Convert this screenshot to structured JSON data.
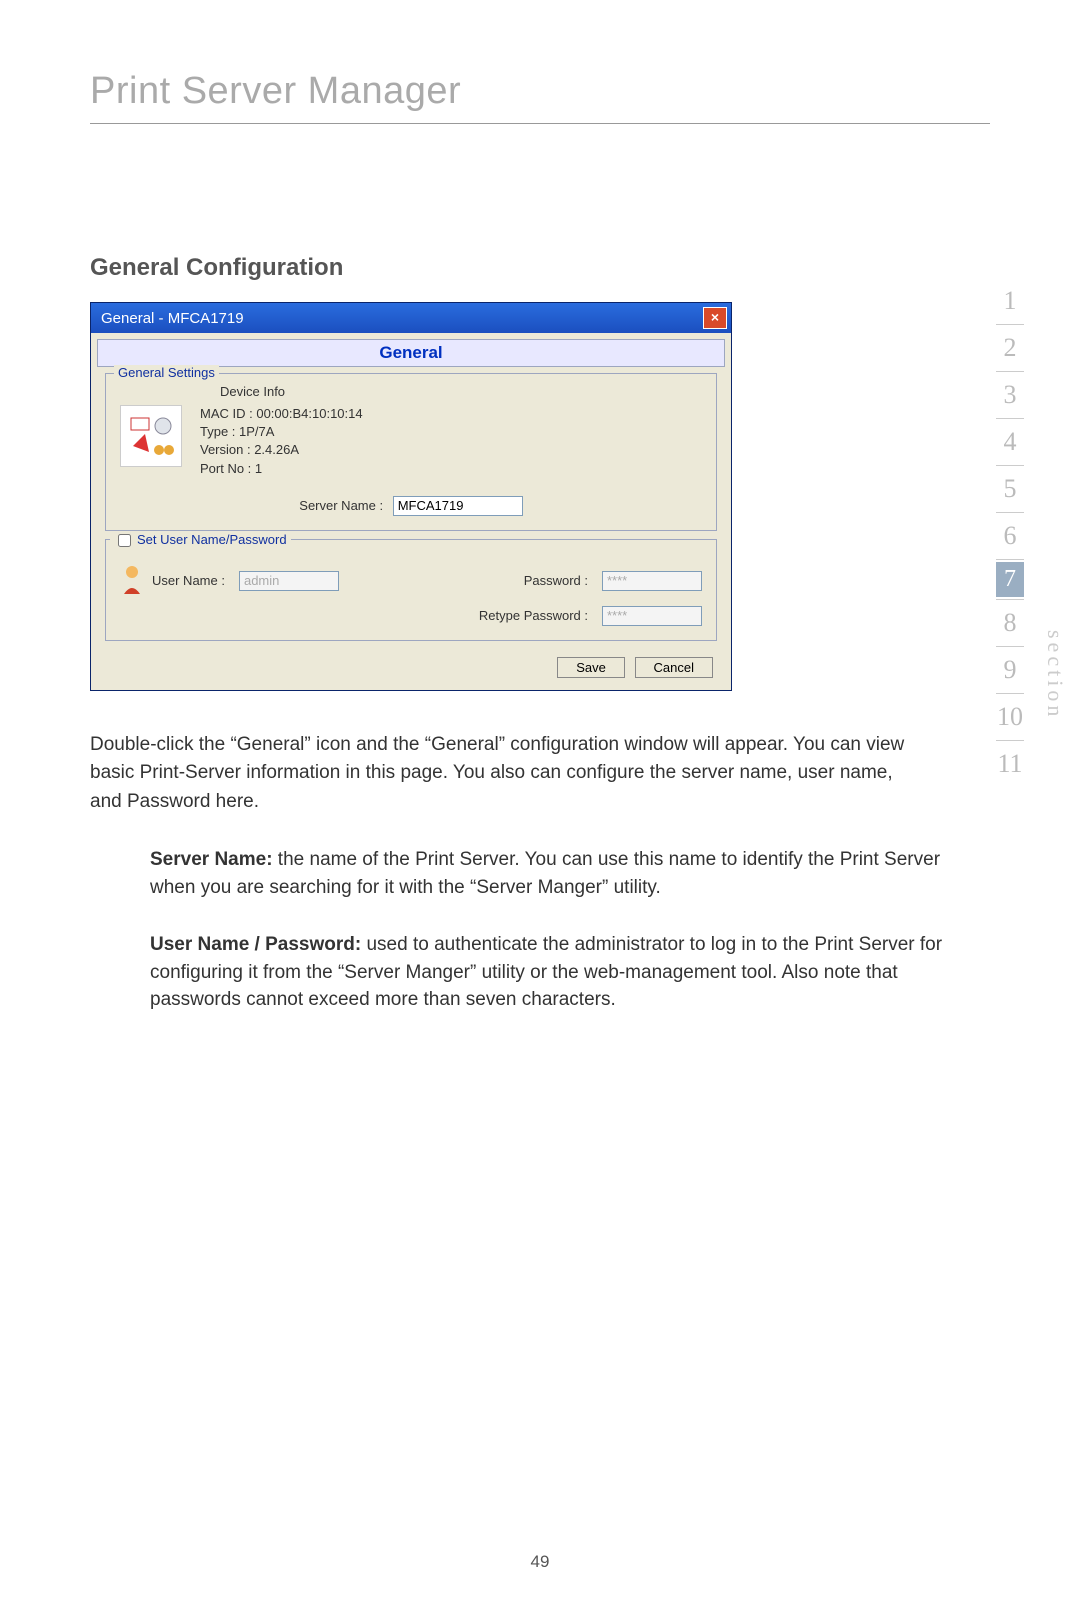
{
  "page": {
    "title": "Print Server Manager",
    "subtitle": "General Configuration",
    "number": "49"
  },
  "dialog": {
    "title": "General - MFCA1719",
    "tab": "General",
    "general_legend": "General Settings",
    "device_info_label": "Device Info",
    "mac_line": "MAC ID : 00:00:B4:10:10:14",
    "type_line": "Type : 1P/7A",
    "version_line": "Version : 2.4.26A",
    "port_line": "Port No : 1",
    "server_name_label": "Server Name :",
    "server_name_value": "MFCA1719",
    "set_user_label": "Set User Name/Password",
    "user_name_label": "User Name :",
    "user_name_value": "admin",
    "password_label": "Password :",
    "password_value": "****",
    "retype_label": "Retype Password :",
    "retype_value": "****",
    "save": "Save",
    "cancel": "Cancel"
  },
  "body": {
    "para1": "Double-click the “General” icon and the “General” configuration window will appear. You can view basic Print-Server information in this page. You also can configure the server name, user name, and Password here.",
    "server_name_bold": "Server Name:",
    "server_name_text": " the name of the Print Server. You can use this name to identify the Print Server when you are searching for it with the “Server Manger” utility.",
    "userpass_bold": "User Name / Password:",
    "userpass_text": " used to authenticate the administrator to log in to the Print Server for configuring it from the “Server Manger” utility or the web-management tool. Also note that passwords cannot exceed more than seven characters."
  },
  "nav": {
    "label": "section",
    "items": [
      "1",
      "2",
      "3",
      "4",
      "5",
      "6",
      "7",
      "8",
      "9",
      "10",
      "11"
    ],
    "active": "7"
  }
}
